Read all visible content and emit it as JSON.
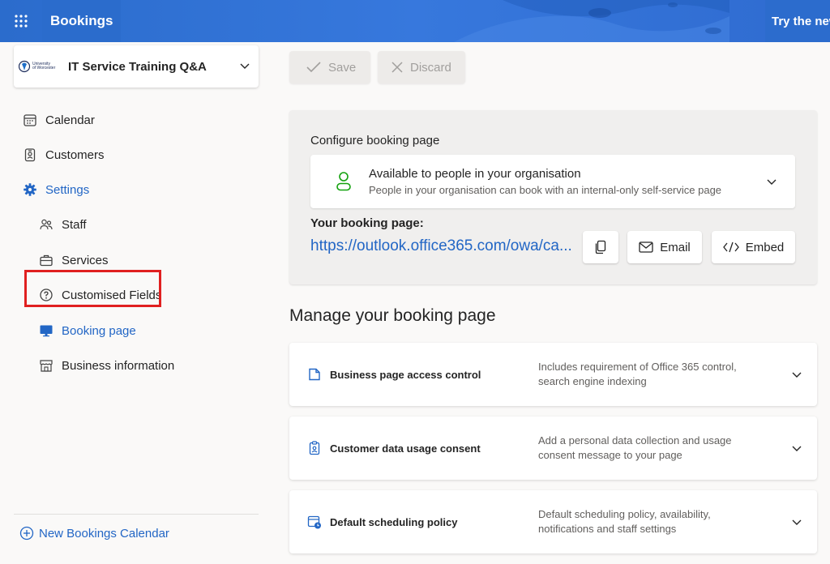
{
  "header": {
    "app_title": "Bookings",
    "promo_text": "Try the new"
  },
  "calendar_selector": {
    "logo_line1": "University",
    "logo_line2": "of Worcester",
    "name": "IT Service Training Q&A"
  },
  "sidebar": {
    "items": [
      {
        "label": "Calendar",
        "icon": "calendar-icon"
      },
      {
        "label": "Customers",
        "icon": "contact-card-icon"
      },
      {
        "label": "Settings",
        "icon": "gear-icon"
      },
      {
        "label": "Staff",
        "icon": "people-icon"
      },
      {
        "label": "Services",
        "icon": "briefcase-icon"
      },
      {
        "label": "Customised Fields",
        "icon": "question-circle-icon"
      },
      {
        "label": "Booking page",
        "icon": "monitor-icon"
      },
      {
        "label": "Business information",
        "icon": "storefront-icon"
      }
    ],
    "new_calendar": "New Bookings Calendar",
    "highlight_color": "#e02020",
    "accent_color": "#2266c5"
  },
  "toolbar": {
    "save_label": "Save",
    "discard_label": "Discard"
  },
  "config": {
    "title": "Configure booking page",
    "availability_title": "Available to people in your organisation",
    "availability_desc": "People in your organisation can book with an internal-only self-service page",
    "link_label": "Your booking page:",
    "link_url": "https://outlook.office365.com/owa/ca...",
    "email_label": "Email",
    "embed_label": "Embed"
  },
  "manage": {
    "title": "Manage your booking page",
    "sections": [
      {
        "title": "Business page access control",
        "desc": "Includes requirement of Office 365 control, search engine indexing",
        "icon": "page-icon"
      },
      {
        "title": "Customer data usage consent",
        "desc": "Add a personal data collection and usage consent message to your page",
        "icon": "clipboard-person-icon"
      },
      {
        "title": "Default scheduling policy",
        "desc": "Default scheduling policy, availability, notifications and staff settings",
        "icon": "calendar-clock-icon"
      }
    ]
  }
}
